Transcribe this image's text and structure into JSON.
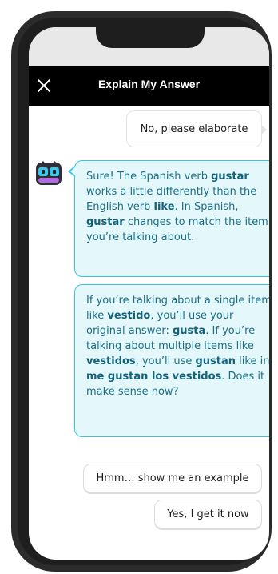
{
  "header": {
    "title": "Explain My Answer",
    "close_icon": "close-icon"
  },
  "messages": [
    {
      "role": "user",
      "text": "No, please elaborate"
    },
    {
      "role": "assistant",
      "segments": [
        {
          "t": "Sure! The Spanish verb ",
          "b": false
        },
        {
          "t": "gustar",
          "b": true
        },
        {
          "t": " works a little differently than the English verb ",
          "b": false
        },
        {
          "t": "like",
          "b": true
        },
        {
          "t": ". In Spanish, ",
          "b": false
        },
        {
          "t": "gustar",
          "b": true
        },
        {
          "t": " changes to match the item you’re talking about.",
          "b": false
        }
      ]
    },
    {
      "role": "assistant",
      "segments": [
        {
          "t": "If you’re talking about a single item like ",
          "b": false
        },
        {
          "t": "vestido",
          "b": true
        },
        {
          "t": ", you’ll use your original answer: ",
          "b": false
        },
        {
          "t": "gusta",
          "b": true
        },
        {
          "t": ". If you’re talking about multiple items like ",
          "b": false
        },
        {
          "t": "vestidos",
          "b": true
        },
        {
          "t": ", you’ll use ",
          "b": false
        },
        {
          "t": "gustan",
          "b": true
        },
        {
          "t": " like in ",
          "b": false
        },
        {
          "t": "me gustan los vestidos",
          "b": true
        },
        {
          "t": ". Does it make sense now?",
          "b": false
        }
      ]
    }
  ],
  "quick_replies": [
    "Hmm… show me an example",
    "Yes, I get it now"
  ],
  "colors": {
    "header_bg": "#000000",
    "ai_bubble_bg": "#e4f8fb",
    "ai_bubble_border": "#35c6e6",
    "ai_text": "#1a6f87"
  }
}
